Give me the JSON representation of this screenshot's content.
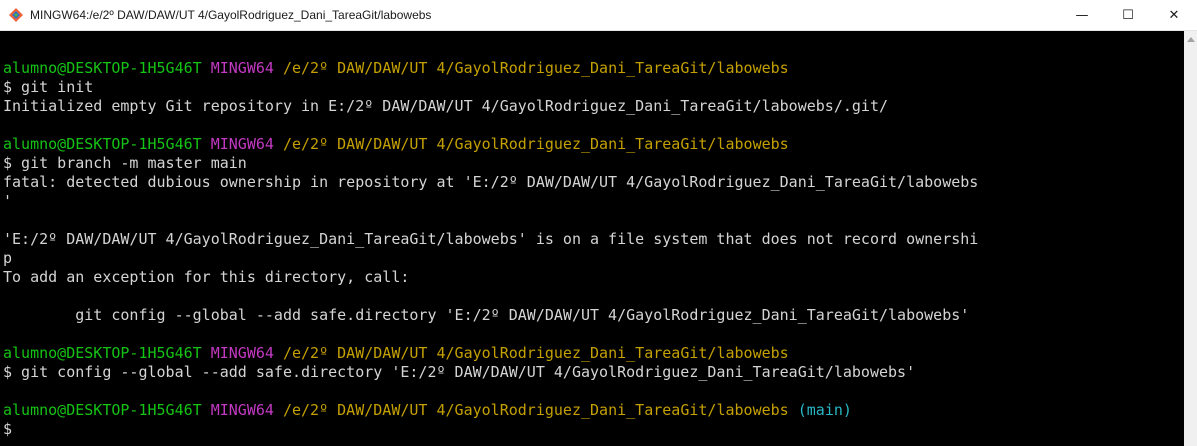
{
  "window": {
    "title": "MINGW64:/e/2º DAW/DAW/UT 4/GayolRodriguez_Dani_TareaGit/labowebs",
    "minimize": "—",
    "maximize": "☐",
    "close": "✕",
    "icon": "git-bash-icon"
  },
  "colors": {
    "user": "#15c315",
    "mingw": "#c339c3",
    "path": "#c4a000",
    "branch": "#2ab7c4",
    "text": "#d4d4d4",
    "background": "#000000"
  },
  "prompt": {
    "user": "alumno@DESKTOP-1H5G46T",
    "shell": "MINGW64",
    "path": "/e/2º DAW/DAW/UT 4/GayolRodriguez_Dani_TareaGit/labowebs",
    "branch": "(main)"
  },
  "lines": {
    "cmd1": "$ git init",
    "out1": "Initialized empty Git repository in E:/2º DAW/DAW/UT 4/GayolRodriguez_Dani_TareaGit/labowebs/.git/",
    "cmd2": "$ git branch -m master main",
    "out2a": "fatal: detected dubious ownership in repository at 'E:/2º DAW/DAW/UT 4/GayolRodriguez_Dani_TareaGit/labowebs",
    "out2b": "'",
    "out2c": "'E:/2º DAW/DAW/UT 4/GayolRodriguez_Dani_TareaGit/labowebs' is on a file system that does not record ownershi",
    "out2d": "p",
    "out2e": "To add an exception for this directory, call:",
    "out2f": "        git config --global --add safe.directory 'E:/2º DAW/DAW/UT 4/GayolRodriguez_Dani_TareaGit/labowebs'",
    "cmd3": "$ git config --global --add safe.directory 'E:/2º DAW/DAW/UT 4/GayolRodriguez_Dani_TareaGit/labowebs'",
    "cmd4": "$"
  }
}
